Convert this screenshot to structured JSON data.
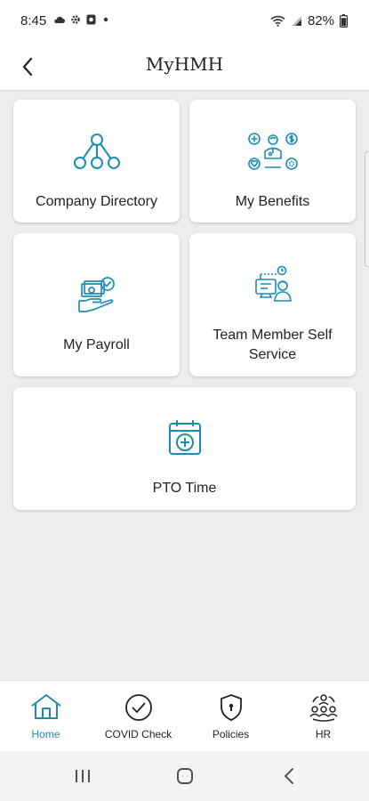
{
  "status_bar": {
    "time": "8:45",
    "battery": "82%",
    "left_icons": [
      "cloud-icon",
      "gear-icon",
      "app-icon",
      "dot-icon"
    ],
    "right_icons": [
      "wifi-icon",
      "signal-icon",
      "battery-icon"
    ]
  },
  "app_bar": {
    "title": "MyHMH",
    "back_icon": "chevron-left-icon"
  },
  "tiles": [
    {
      "label": "Company Directory",
      "icon": "org-network-icon"
    },
    {
      "label": "My Benefits",
      "icon": "benefits-icon"
    },
    {
      "label": "My Payroll",
      "icon": "payroll-hand-icon"
    },
    {
      "label": "Team Member Self Service",
      "icon": "self-service-icon"
    },
    {
      "label": "PTO Time",
      "icon": "calendar-plus-icon"
    }
  ],
  "bottom_nav": [
    {
      "label": "Home",
      "icon": "home-icon",
      "active": true
    },
    {
      "label": "COVID Check",
      "icon": "check-circle-icon",
      "active": false
    },
    {
      "label": "Policies",
      "icon": "shield-lock-icon",
      "active": false
    },
    {
      "label": "HR",
      "icon": "people-cycle-icon",
      "active": false
    }
  ],
  "system_nav": [
    "recents-icon",
    "home-circle-icon",
    "back-chevron-icon"
  ],
  "colors": {
    "accent": "#1b8db3",
    "background": "#ededed",
    "card": "#ffffff"
  }
}
